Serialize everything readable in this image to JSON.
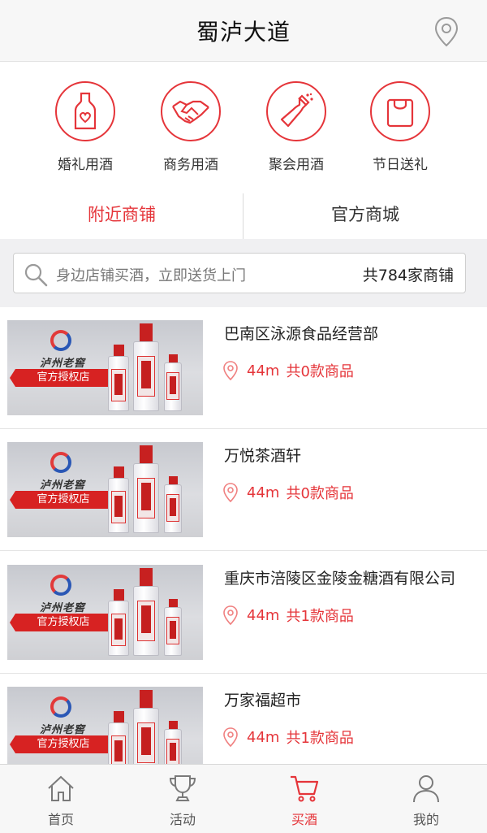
{
  "header": {
    "title": "蜀泸大道",
    "location_icon": "location-pin-icon"
  },
  "categories": [
    {
      "label": "婚礼用酒",
      "icon": "wine-bottle-heart-icon"
    },
    {
      "label": "商务用酒",
      "icon": "handshake-icon"
    },
    {
      "label": "聚会用酒",
      "icon": "champagne-bottle-icon"
    },
    {
      "label": "节日送礼",
      "icon": "gift-bag-icon"
    }
  ],
  "tabs": [
    {
      "label": "附近商铺",
      "active": true
    },
    {
      "label": "官方商城",
      "active": false
    }
  ],
  "search": {
    "placeholder": "身边店铺买酒，立即送货上门",
    "count_label": "共784家商铺"
  },
  "stores": [
    {
      "name": "巴南区泳源食品经营部",
      "distance": "44m",
      "goods": "共0款商品",
      "brand": "泸州老窖",
      "badge": "官方授权店"
    },
    {
      "name": "万悦茶酒轩",
      "distance": "44m",
      "goods": "共0款商品",
      "brand": "泸州老窖",
      "badge": "官方授权店"
    },
    {
      "name": "重庆市涪陵区金陵金糖酒有限公司",
      "distance": "44m",
      "goods": "共1款商品",
      "brand": "泸州老窖",
      "badge": "官方授权店"
    },
    {
      "name": "万家福超市",
      "distance": "44m",
      "goods": "共1款商品",
      "brand": "泸州老窖",
      "badge": "官方授权店"
    }
  ],
  "bottom_nav": [
    {
      "label": "首页",
      "icon": "home-icon",
      "active": false
    },
    {
      "label": "活动",
      "icon": "trophy-icon",
      "active": false
    },
    {
      "label": "买酒",
      "icon": "cart-icon",
      "active": true
    },
    {
      "label": "我的",
      "icon": "user-icon",
      "active": false
    }
  ],
  "colors": {
    "accent": "#e5353a",
    "header_bg": "#f7f7f7",
    "search_bg": "#f0f0f2"
  }
}
